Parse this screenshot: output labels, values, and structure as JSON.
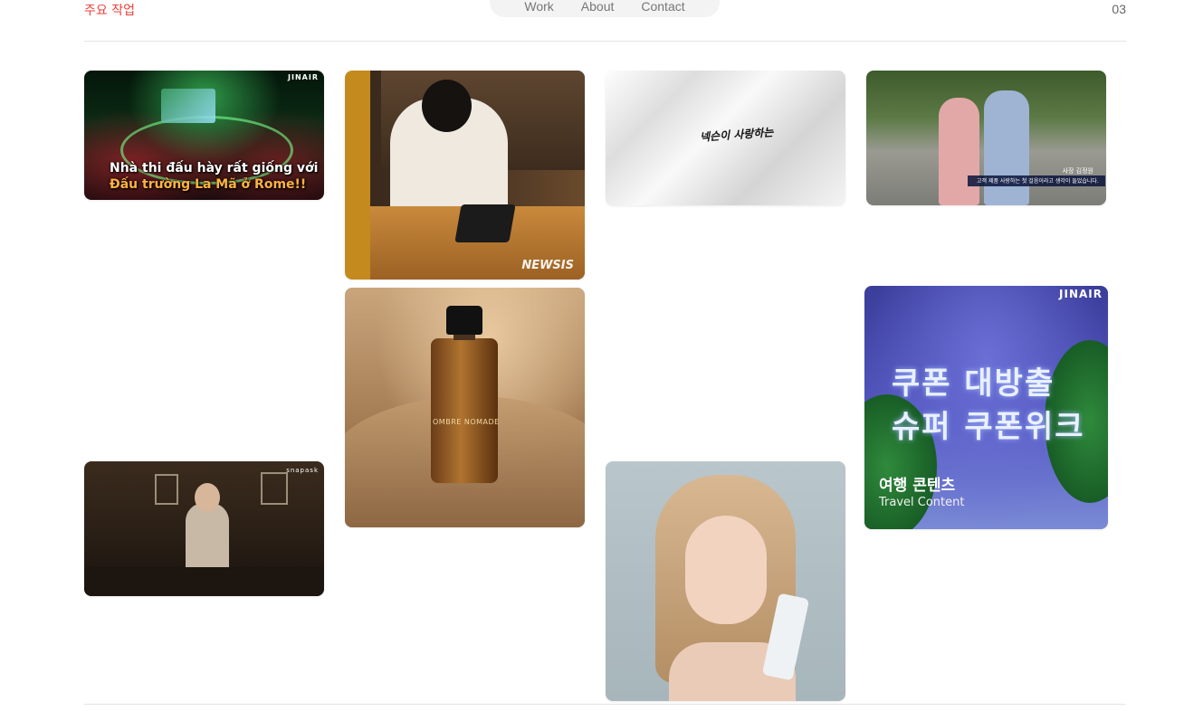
{
  "header": {
    "section_label": "주요 작업",
    "nav": [
      {
        "label": "Work"
      },
      {
        "label": "About"
      },
      {
        "label": "Contact"
      }
    ],
    "counter": "03"
  },
  "gallery": {
    "tile1": {
      "caption_line1": "Nhà thi đấu hày rất giống với",
      "caption_line2": "Đấu trường La Mã ở Rome!!",
      "brand": "JINAIR"
    },
    "tile2": {
      "watermark": "NEWSIS"
    },
    "tile3": {
      "logo_text": "넥슨이 사랑하는"
    },
    "tile4": {
      "name_tag": "사장 김정원",
      "lower_third": "고객 제품 사랑하는 첫 걸음이라고 생각이 들었습니다."
    },
    "tile5": {
      "bottle_label": "OMBRE NOMADE"
    },
    "tile6": {
      "brand": "JINAIR",
      "headline1": "쿠폰 대방출",
      "headline2": "슈퍼 쿠폰위크",
      "title_ko": "여행 콘텐츠",
      "title_en": "Travel Content"
    },
    "tile7": {
      "brand": "snapask"
    },
    "tile8": {}
  },
  "colors": {
    "accent": "#e8423a",
    "rule": "#e3e3e3",
    "nav_bg": "#f3f3f3"
  }
}
